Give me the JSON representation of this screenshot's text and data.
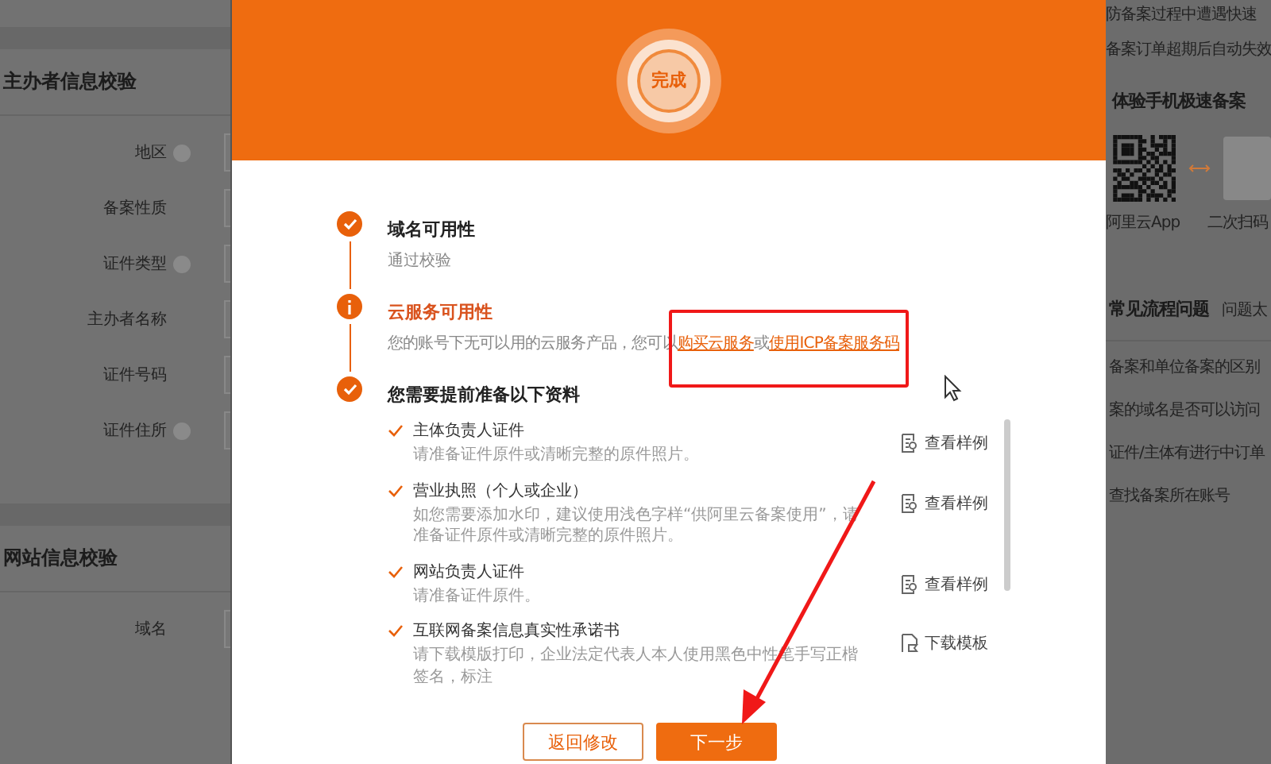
{
  "left_panel": {
    "sections": [
      {
        "title": "主办者信息校验",
        "fields": [
          {
            "label": "地区",
            "help": true
          },
          {
            "label": "备案性质",
            "help": false
          },
          {
            "label": "证件类型",
            "help": true
          },
          {
            "label": "主办者名称",
            "help": false
          },
          {
            "label": "证件号码",
            "help": false
          },
          {
            "label": "证件住所",
            "help": true
          }
        ]
      },
      {
        "title": "网站信息校验",
        "fields": [
          {
            "label": "域名",
            "help": false
          }
        ]
      }
    ]
  },
  "modal": {
    "badge": "完成",
    "steps": [
      {
        "kind": "done",
        "title": "域名可用性",
        "description": "通过校验"
      },
      {
        "kind": "warning",
        "title": "云服务可用性",
        "description": "您的账号下无可以用的云服务产品，您可以",
        "links": [
          "购买云服务",
          "使用ICP备案服务码"
        ],
        "link_separator": "或"
      },
      {
        "kind": "done",
        "title": "您需要提前准备以下资料"
      }
    ],
    "materials": [
      {
        "title": "主体负责人证件",
        "description": "请准备证件原件或清晰完整的原件照片。",
        "action": "查看样例",
        "kind": "view"
      },
      {
        "title": "营业执照（个人或企业）",
        "description": "如您需要添加水印，建议使用浅色字样“供阿里云备案使用”，请准备证件原件或清晰完整的原件照片。",
        "action": "查看样例",
        "kind": "view"
      },
      {
        "title": "网站负责人证件",
        "description": "请准备证件原件。",
        "action": "查看样例",
        "kind": "view"
      },
      {
        "title": "互联网备案信息真实性承诺书",
        "description": "请下载模版打印，企业法定代表人本人使用黑色中性笔手写正楷签名，标注",
        "action": "下载模板",
        "kind": "download"
      }
    ],
    "buttons": [
      {
        "label": "返回修改",
        "kind": "secondary"
      },
      {
        "label": "下一步",
        "kind": "primary"
      }
    ]
  },
  "right_panel": {
    "notices": [
      "防备案过程中遭遇快速",
      "备案订单超期后自动失效"
    ],
    "app_title": "体验手机极速备案",
    "app_captions": [
      "阿里云App",
      "二次扫码"
    ],
    "faq_title": "常见流程问题",
    "faq_more": "问题太",
    "faq_items": [
      "备案和单位备案的区别",
      "案的域名是否可以访问",
      "证件/主体有进行中订单",
      "查找备案所在账号"
    ]
  }
}
